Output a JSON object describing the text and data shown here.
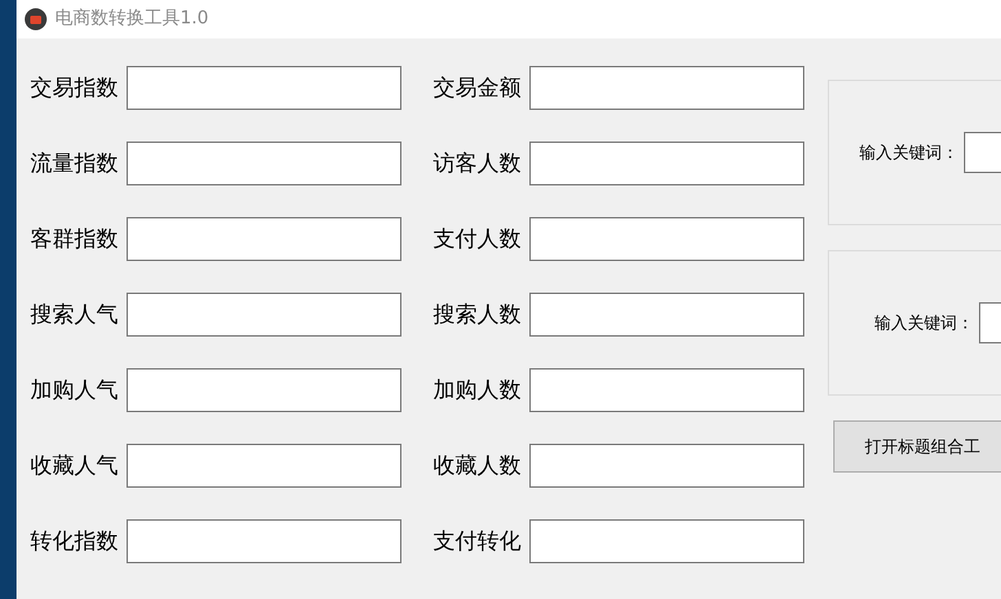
{
  "window": {
    "title": "电商数转换工具1.0"
  },
  "fields": [
    {
      "left": {
        "label": "交易指数"
      },
      "right": {
        "label": "交易金额"
      }
    },
    {
      "left": {
        "label": "流量指数"
      },
      "right": {
        "label": "访客人数"
      }
    },
    {
      "left": {
        "label": "客群指数"
      },
      "right": {
        "label": "支付人数"
      }
    },
    {
      "left": {
        "label": "搜索人气"
      },
      "right": {
        "label": "搜索人数"
      }
    },
    {
      "left": {
        "label": "加购人气"
      },
      "right": {
        "label": "加购人数"
      }
    },
    {
      "left": {
        "label": "收藏人气"
      },
      "right": {
        "label": "收藏人数"
      }
    },
    {
      "left": {
        "label": "转化指数"
      },
      "right": {
        "label": "支付转化"
      }
    }
  ],
  "keyword_groups": [
    {
      "label": "输入关键词："
    },
    {
      "label": "输入关键词："
    }
  ],
  "button": {
    "label": "打开标题组合工"
  }
}
